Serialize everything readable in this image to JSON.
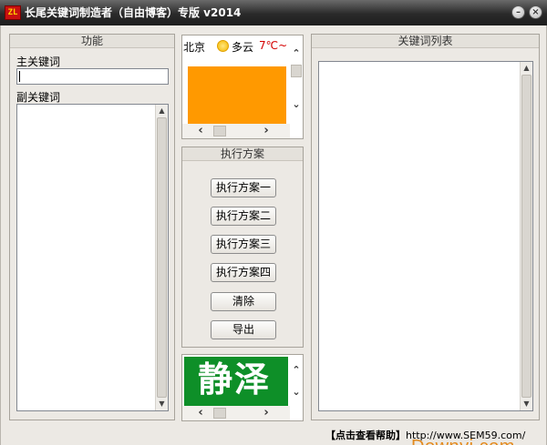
{
  "window": {
    "icon_text": "ZL",
    "title": "长尾关键词制造者（自由博客）专版 v2014",
    "minimize_glyph": "–",
    "close_glyph": "×"
  },
  "function_panel": {
    "title": "功能",
    "main_keyword_label": "主关键词",
    "main_keyword_value": "",
    "sub_keyword_label": "副关键词",
    "sub_keyword_value": ""
  },
  "weather": {
    "city": "北京",
    "icon": "sun-icon",
    "condition": "多云",
    "temperature": "7℃~",
    "accent": "#ff9900"
  },
  "scheme_panel": {
    "title": "执行方案",
    "buttons": [
      "执行方案一",
      "执行方案二",
      "执行方案三",
      "执行方案四",
      "清除",
      "导出"
    ]
  },
  "ad": {
    "text": "静泽",
    "color": "#0e8f28"
  },
  "keyword_list": {
    "title": "关键词列表",
    "items": []
  },
  "footer": {
    "help_label": "【点击查看帮助】",
    "help_url": "http://www.SEM59.com/",
    "watermark": "Downyi.com"
  }
}
